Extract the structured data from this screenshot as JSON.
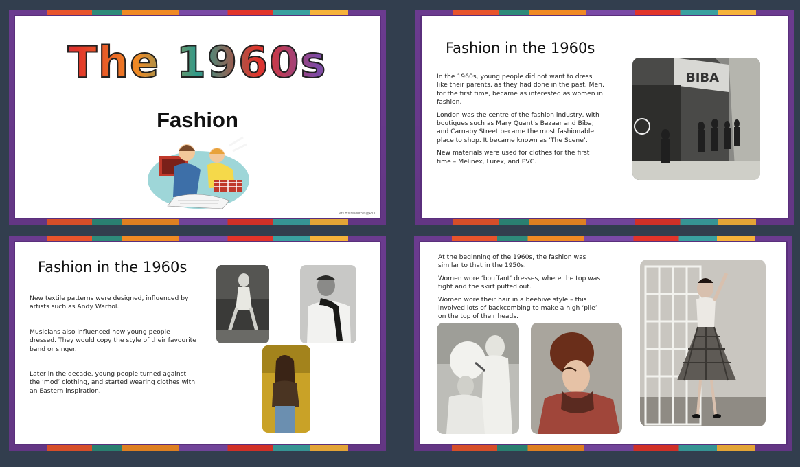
{
  "slide1": {
    "title": "The 1960s",
    "subtitle": "Fashion",
    "credit": "Mrs B's resources@PTT",
    "illustration_icon": "sewing-women-illustration"
  },
  "slide2": {
    "heading": "Fashion in the 1960s",
    "paragraphs": [
      "In the 1960s, young people did not want to dress like their parents, as they had done in the past. Men, for the first time, became as interested as women in fashion.",
      "London was the centre of the fashion industry, with boutiques such as Mary Quant’s Bazaar and Biba; and Carnaby Street became the most fashionable place to shop. It became known as ‘The Scene’.",
      "New materials were used for clothes for the first time – Melinex, Lurex, and PVC."
    ],
    "photo_sign": "BIBA"
  },
  "slide3": {
    "heading": "Fashion in the 1960s",
    "paragraphs": [
      "New textile patterns were designed, influenced by artists such as Andy Warhol.",
      "Musicians also influenced how young people dressed. They would copy the style of their favourite band or singer.",
      "Later in the decade, young people turned against the ‘mod’ clothing, and started wearing clothes with an Eastern inspiration."
    ]
  },
  "slide4": {
    "paragraphs": [
      "At the beginning of the 1960s, the fashion was similar to that in the 1950s.",
      "Women wore ‘bouffant’ dresses, where the top was tight and the skirt puffed out.",
      "Women wore their hair in a beehive style – this involved lots of backcombing to make a high ‘pile’ on the top of their heads."
    ]
  },
  "colors": {
    "background": "#323e4e",
    "border_purple": "#5a2f7c",
    "accent_orange": "#f08a24",
    "accent_red": "#e2342a",
    "accent_teal": "#2e8a7a"
  }
}
